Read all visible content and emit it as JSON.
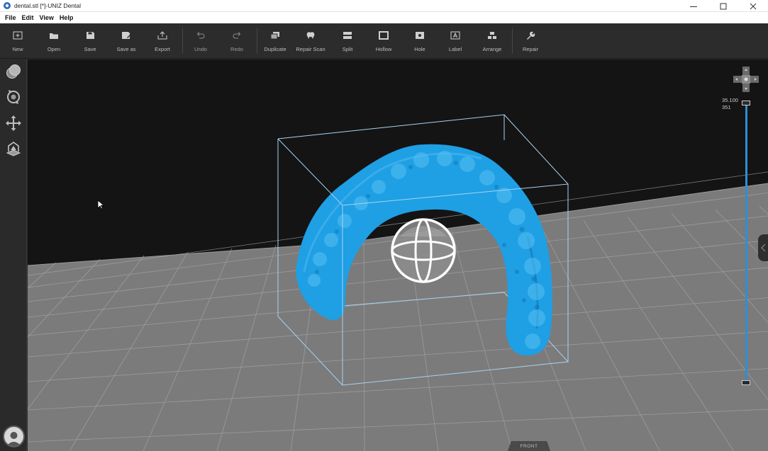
{
  "window": {
    "title": "dental.stl [*]-UNIZ Dental",
    "minimize_icon": "minimize-icon",
    "maximize_icon": "maximize-icon",
    "close_icon": "close-icon"
  },
  "menu": [
    "File",
    "Edit",
    "View",
    "Help"
  ],
  "toolbar": {
    "new": {
      "label": "New",
      "icon": "new-icon"
    },
    "open": {
      "label": "Open",
      "icon": "folder-open-icon"
    },
    "save": {
      "label": "Save",
      "icon": "save-icon"
    },
    "save_as": {
      "label": "Save as",
      "icon": "save-as-icon"
    },
    "export": {
      "label": "Export",
      "icon": "export-icon"
    },
    "undo": {
      "label": "Undo",
      "icon": "undo-icon"
    },
    "redo": {
      "label": "Redo",
      "icon": "redo-icon"
    },
    "duplicate": {
      "label": "Duplicate",
      "icon": "duplicate-icon"
    },
    "repair_scan": {
      "label": "Repair Scan",
      "icon": "tooth-icon"
    },
    "split": {
      "label": "Split",
      "icon": "split-icon"
    },
    "hollow": {
      "label": "Hollow",
      "icon": "hollow-icon"
    },
    "hole": {
      "label": "Hole",
      "icon": "hole-icon"
    },
    "label": {
      "label": "Label",
      "icon": "label-icon"
    },
    "arrange": {
      "label": "Arrange",
      "icon": "arrange-icon"
    },
    "repair": {
      "label": "Repair",
      "icon": "wrench-icon"
    }
  },
  "sidebar": [
    "view-shading-icon",
    "rotate-icon",
    "move-icon",
    "platform-icon",
    "account-icon"
  ],
  "viewport": {
    "height_value": "35.100",
    "layer_value": "351",
    "front_label": "FRONT",
    "model_color": "#1f9fe4",
    "slider_color": "#2d8fd6",
    "platform_color": "#7b7b7b"
  }
}
